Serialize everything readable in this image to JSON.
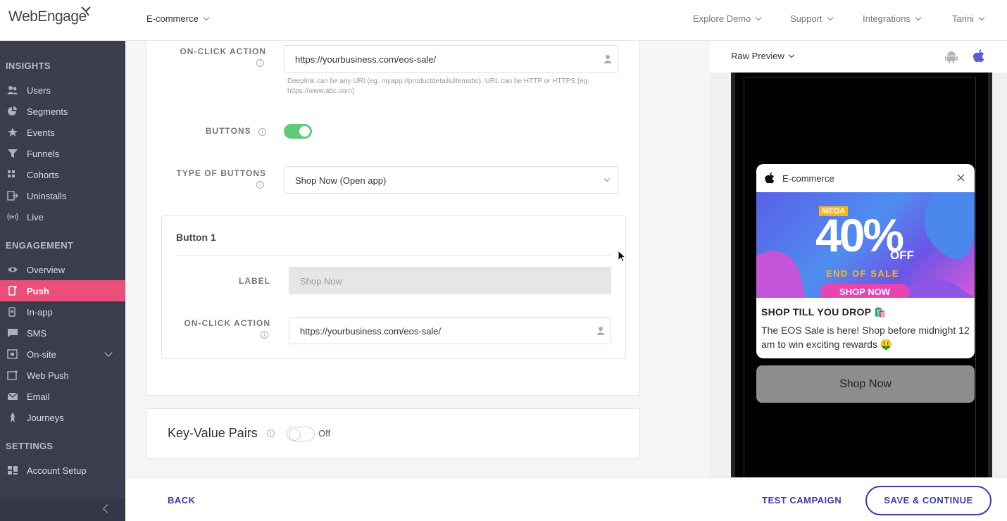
{
  "brand": {
    "logo_text_a": "Web",
    "logo_text_b": "Engage"
  },
  "topbar": {
    "project": "E-commerce",
    "nav": [
      "Explore Demo",
      "Support",
      "Integrations",
      "Tarini"
    ]
  },
  "sidebar": {
    "insights_title": "INSIGHTS",
    "insights": [
      "Users",
      "Segments",
      "Events",
      "Funnels",
      "Cohorts",
      "Uninstalls",
      "Live"
    ],
    "engagement_title": "ENGAGEMENT",
    "engagement": [
      "Overview",
      "Push",
      "In-app",
      "SMS",
      "On-site",
      "Web Push",
      "Email",
      "Journeys"
    ],
    "settings_title": "SETTINGS",
    "settings": [
      "Account Setup"
    ]
  },
  "form": {
    "onclick_label": "ON-CLICK ACTION",
    "onclick_value": "https://yourbusiness.com/eos-sale/",
    "deeplink_hint": "Deeplink can be any URI (eg. myapp://productdetails/itemabc). URL can be HTTP or HTTPS (eg. https://www.abc.com)",
    "buttons_label": "BUTTONS",
    "buttons_on": true,
    "type_label": "TYPE OF BUTTONS",
    "type_value": "Shop Now (Open app)",
    "button1_title": "Button 1",
    "label_label": "LABEL",
    "label_value": "Shop Now",
    "b1_onclick_label": "ON-CLICK ACTION",
    "b1_onclick_value": "https://yourbusiness.com/eos-sale/",
    "kv_title": "Key-Value Pairs",
    "kv_state": "Off"
  },
  "preview": {
    "mode": "Raw Preview",
    "app_name": "E-commerce",
    "banner_mega": "MEGA",
    "banner_percent": "40%",
    "banner_off": "OFF",
    "banner_eos": "END OF SALE",
    "banner_shop": "SHOP NOW",
    "title": "SHOP TILL YOU DROP 🛍️",
    "body": "The EOS Sale is here! Shop before midnight 12 am to win exciting rewards 🤑",
    "button": "Shop Now"
  },
  "footer": {
    "back": "BACK",
    "test": "TEST CAMPAIGN",
    "save": "SAVE & CONTINUE"
  },
  "colors": {
    "accent": "#ea4f79",
    "sidebar": "#3a3d4c",
    "primary": "#3c3cad",
    "toggle_on": "#61c97a"
  }
}
